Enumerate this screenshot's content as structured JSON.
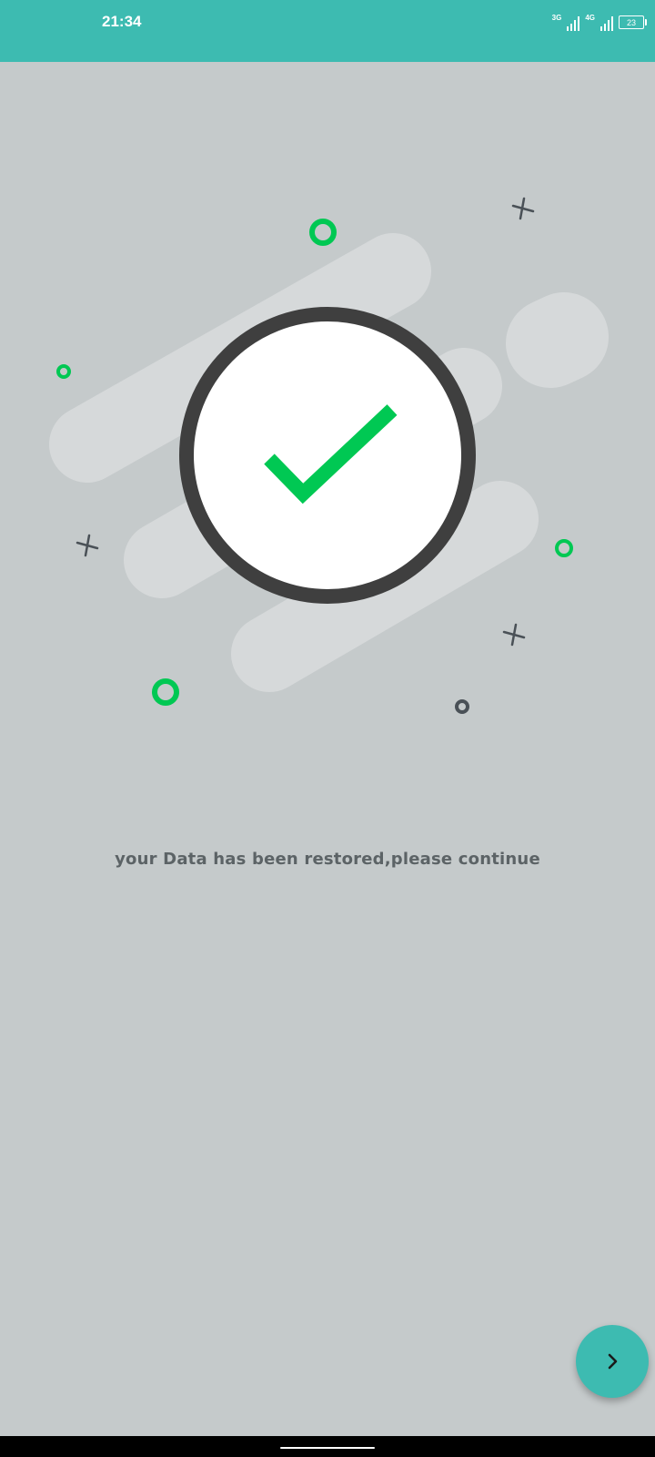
{
  "status_bar": {
    "time": "21:34",
    "network_1": "3G",
    "network_2": "4G",
    "battery_level": "23",
    "background_color": "#3dbbb1"
  },
  "illustration": {
    "icon": "checkmark-in-circle-icon",
    "accent_color": "#00c853",
    "ring_color": "#3f3f3f"
  },
  "message": {
    "text": "your Data has been restored,please continue"
  },
  "fab": {
    "icon": "chevron-right-icon",
    "color": "#3dbbb1"
  }
}
